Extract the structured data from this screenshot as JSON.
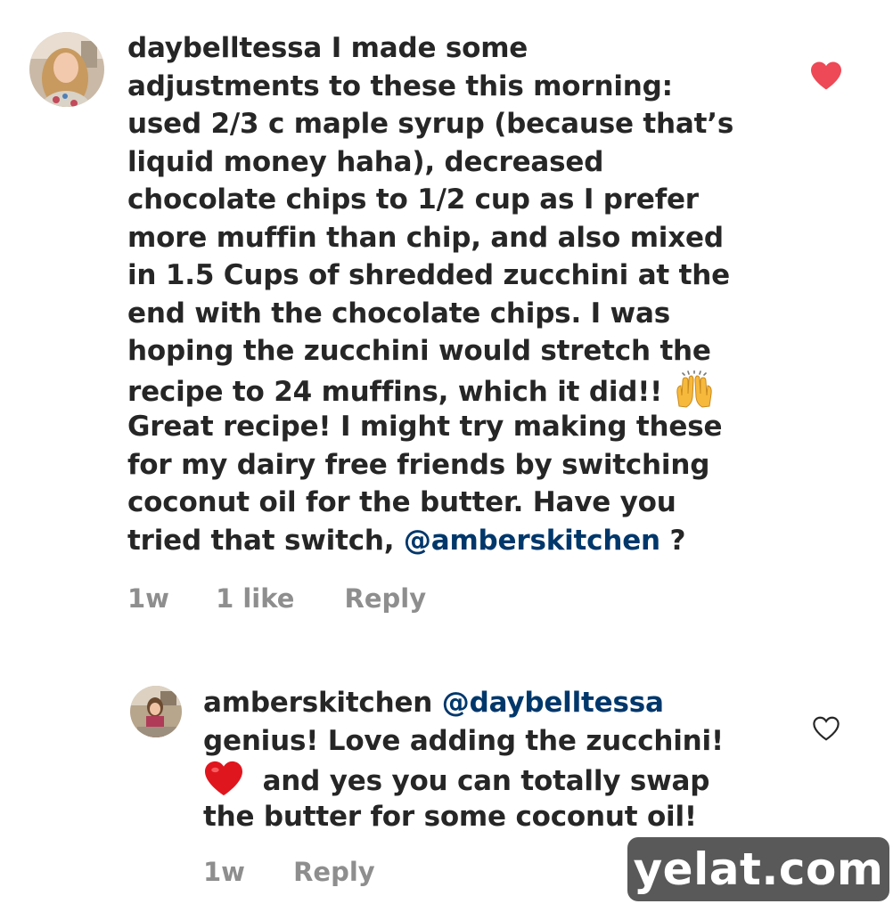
{
  "comment": {
    "username": "daybelltessa",
    "lines": [
      " I made some",
      "adjustments to these this morning:",
      "used 2/3 c maple syrup (because that’s",
      "liquid money haha), decreased",
      "chocolate chips to 1/2 cup as I prefer",
      "more muffin than chip, and also mixed",
      "in 1.5 Cups of shredded zucchini at the",
      "end with the chocolate chips. I was",
      "hoping the zucchini would stretch the",
      "recipe to 24 muffins, which it did!! ",
      "Great recipe! I might try making these",
      "for my dairy free friends by switching",
      "coconut oil for the butter. Have you",
      "tried that switch, "
    ],
    "mention": "@amberskitchen",
    "end": " ?",
    "time": "1w",
    "likes": "1 like",
    "reply": "Reply",
    "liked": true,
    "heart_color": "#ed4956"
  },
  "reply": {
    "username": "amberskitchen",
    "mention": "@daybelltessa",
    "lines": [
      "genius! Love adding the zucchini!",
      " and yes you can totally swap",
      "the butter for some coconut oil!"
    ],
    "time": "1w",
    "reply": "Reply",
    "liked": false
  },
  "watermark": "yelat.com",
  "colors": {
    "text": "#262626",
    "mention": "#00376b",
    "meta": "#8e8e8e"
  }
}
